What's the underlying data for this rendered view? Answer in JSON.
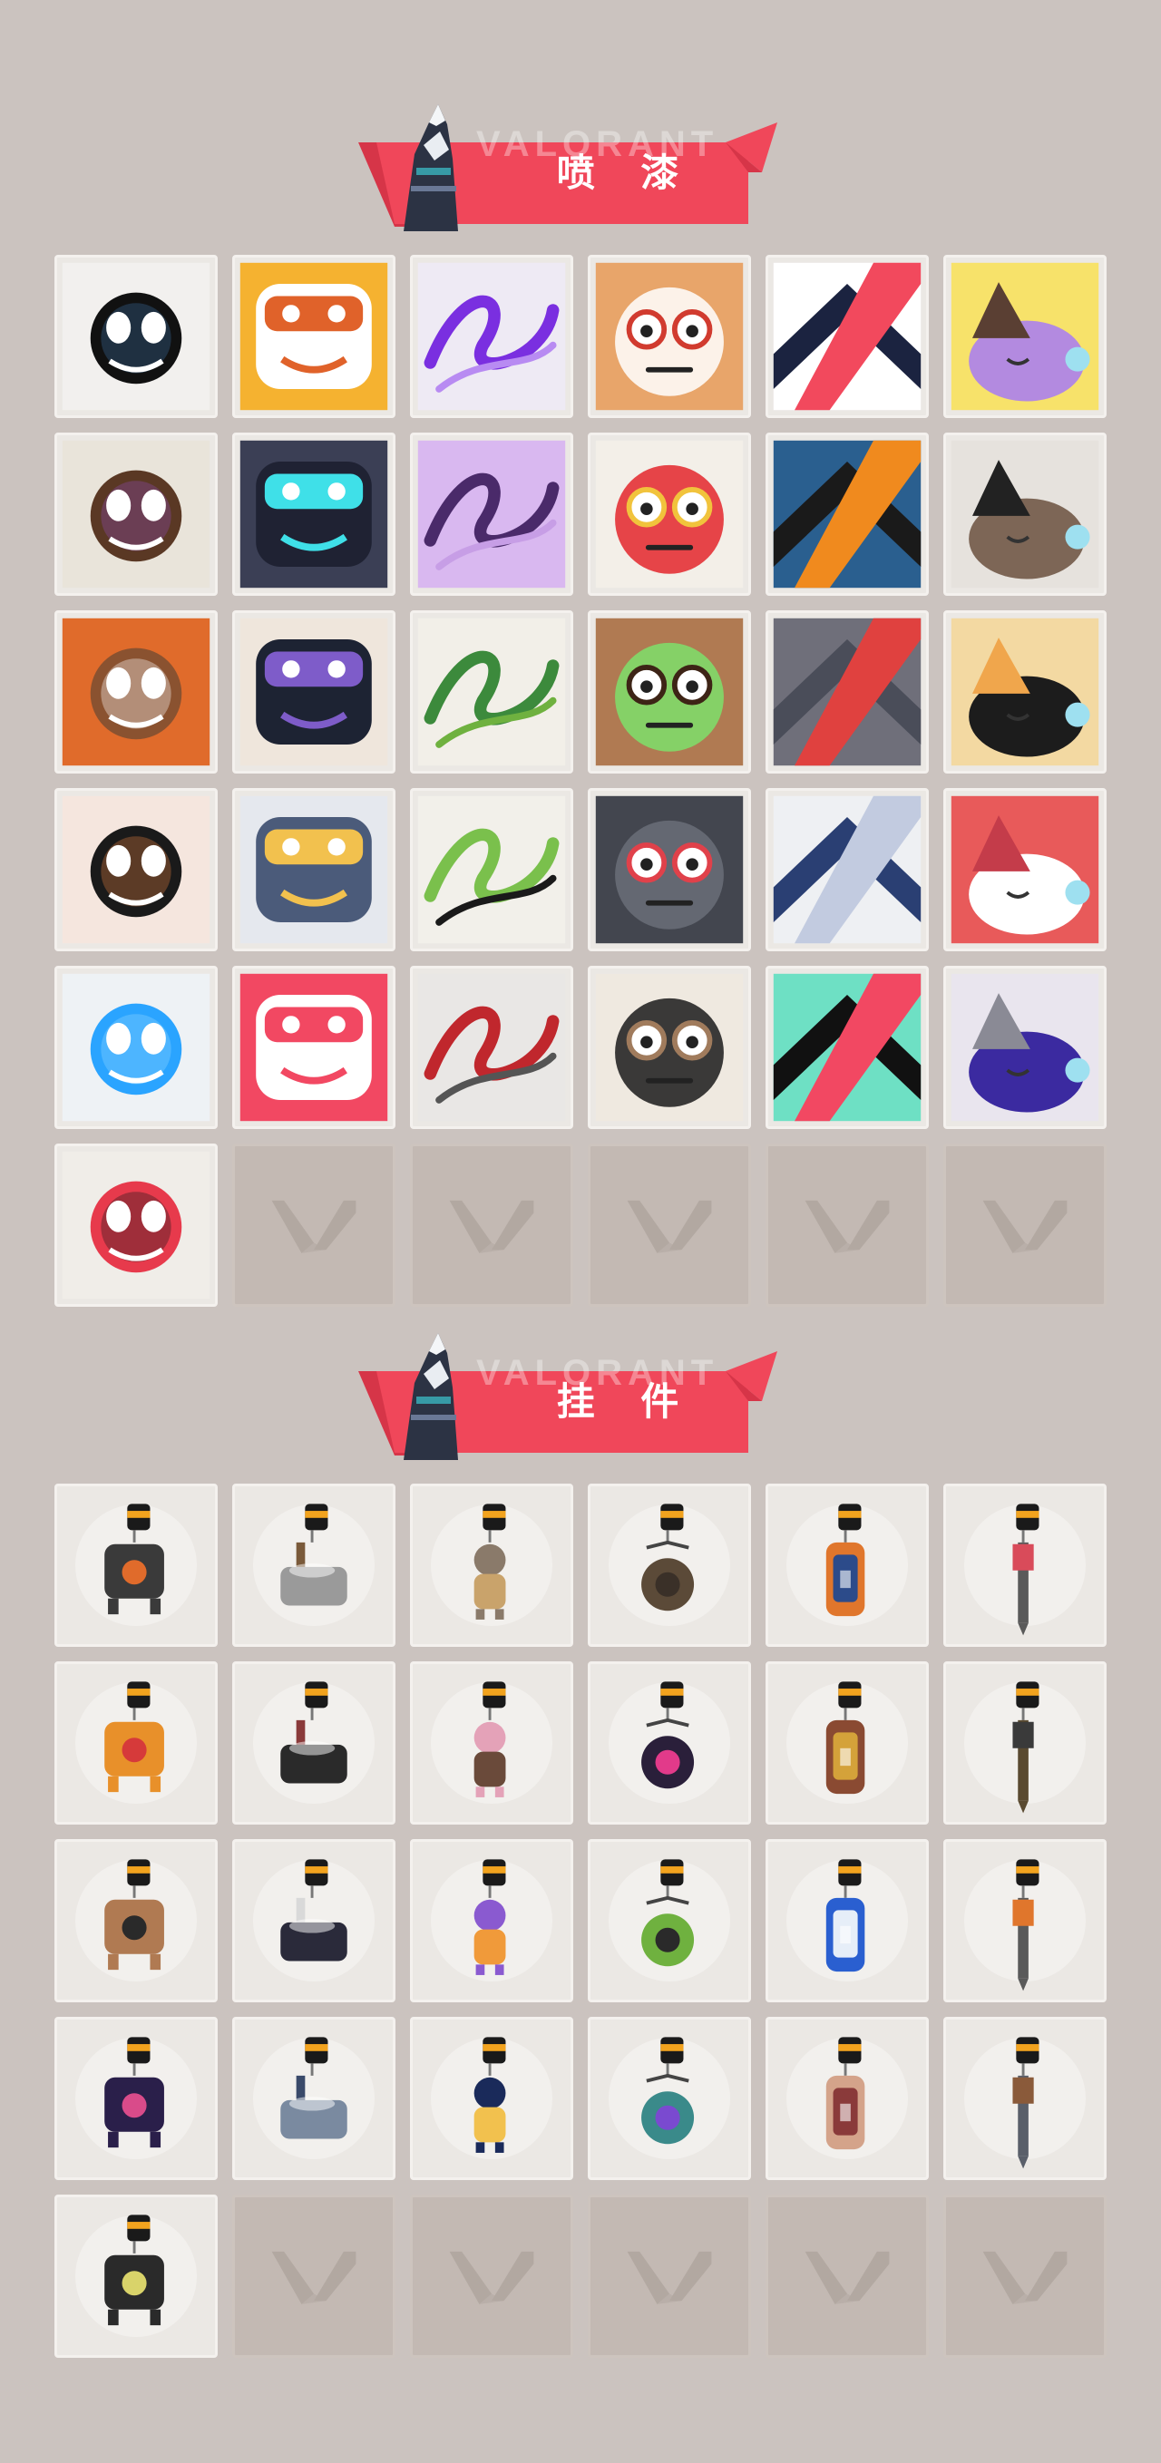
{
  "sections": [
    {
      "title": "喷  漆",
      "title_ghost": "VALORANT",
      "items": [
        {
          "icon": "star-badge-icon",
          "bg": "#f2f0ee",
          "fg": "#111111",
          "accent": "#3a6a9a"
        },
        {
          "icon": "cat-mask-icon",
          "bg": "#f5b230",
          "fg": "#ffffff",
          "accent": "#e0622a"
        },
        {
          "icon": "purple-scribble-icon",
          "bg": "#eeeaf4",
          "fg": "#7a2fe0",
          "accent": "#b88bf2"
        },
        {
          "icon": "goggles-face-icon",
          "bg": "#e8a56a",
          "fg": "#ffffff",
          "accent": "#d13b2f"
        },
        {
          "icon": "chevron-stripe-icon",
          "bg": "#ffffff",
          "fg": "#1b2340",
          "accent": "#f2495d"
        },
        {
          "icon": "sleeping-creature-icon",
          "bg": "#f7e26a",
          "fg": "#b38ae0",
          "accent": "#5a3f33"
        },
        {
          "icon": "pixel-agent-icon",
          "bg": "#e9e4da",
          "fg": "#5a3824",
          "accent": "#8b4bb0"
        },
        {
          "icon": "dark-robot-icon",
          "bg": "#3b3f55",
          "fg": "#1f2233",
          "accent": "#3fe0e8"
        },
        {
          "icon": "dizzy-face-icon",
          "bg": "#d9b8f0",
          "fg": "#4a2a6a",
          "accent": "#c79ee6"
        },
        {
          "icon": "clown-face-icon",
          "bg": "#f3efe8",
          "fg": "#e3262c",
          "accent": "#f1c33c"
        },
        {
          "icon": "orange-button-icon",
          "bg": "#2a5f8f",
          "fg": "#1a1a1a",
          "accent": "#f08a1e"
        },
        {
          "icon": "raccoon-face-icon",
          "bg": "#e6e2dd",
          "fg": "#7d6656",
          "accent": "#222222"
        },
        {
          "icon": "grinning-agent-icon",
          "bg": "#e06b2b",
          "fg": "#8a5230",
          "accent": "#ffffff"
        },
        {
          "icon": "anime-boy-icon",
          "bg": "#efe6dc",
          "fg": "#1d2333",
          "accent": "#7e5cc9"
        },
        {
          "icon": "green-crate-icon",
          "bg": "#f2efe8",
          "fg": "#3c8a3c",
          "accent": "#6fb13f"
        },
        {
          "icon": "green-eyes-icon",
          "bg": "#b07a52",
          "fg": "#7ee06b",
          "accent": "#3d2416"
        },
        {
          "icon": "crying-creature-icon",
          "bg": "#6f6f7a",
          "fg": "#4a4d59",
          "accent": "#e0413f"
        },
        {
          "icon": "tiger-face-icon",
          "bg": "#f3d9a2",
          "fg": "#1c1c1c",
          "accent": "#f0a64c"
        },
        {
          "icon": "woman-pencil-icon",
          "bg": "#f5e6de",
          "fg": "#1a1a1a",
          "accent": "#d97b3f"
        },
        {
          "icon": "penguin-beanie-icon",
          "bg": "#e5e8ee",
          "fg": "#4b5b7a",
          "accent": "#f2c14e"
        },
        {
          "icon": "frog-face-icon",
          "bg": "#f2f0ea",
          "fg": "#7ac04c",
          "accent": "#1a1a1a"
        },
        {
          "icon": "gray-monster-icon",
          "bg": "#43464f",
          "fg": "#6a6e78",
          "accent": "#e0414a"
        },
        {
          "icon": "hooded-agent-icon",
          "bg": "#eef0f3",
          "fg": "#2a3f73",
          "accent": "#c2cbe0"
        },
        {
          "icon": "number-sign-icon",
          "bg": "#e85a5a",
          "fg": "#ffffff",
          "accent": "#c43c4a"
        },
        {
          "icon": "neon-zigzag-icon",
          "bg": "#eef2f5",
          "fg": "#2aa4ff",
          "accent": "#8fd6ff"
        },
        {
          "icon": "pixel-heart-icon",
          "bg": "#f24862",
          "fg": "#ffffff",
          "accent": "#f24862"
        },
        {
          "icon": "red-x-icon",
          "bg": "#e9e7e5",
          "fg": "#c0272d",
          "accent": "#555555"
        },
        {
          "icon": "glasses-agent-icon",
          "bg": "#efe9e0",
          "fg": "#1a1a1a",
          "accent": "#a07b5c"
        },
        {
          "icon": "valorant-splat-icon",
          "bg": "#6ee0c4",
          "fg": "#111111",
          "accent": "#f24862"
        },
        {
          "icon": "graffiti-tag-icon",
          "bg": "#e9e5ee",
          "fg": "#3b2aa0",
          "accent": "#8a8a95"
        },
        {
          "icon": "red-valorant-badge-icon",
          "bg": "#f0ede8",
          "fg": "#e73a4c",
          "accent": "#1a1a1a"
        },
        {
          "icon": "empty-slot",
          "empty": true
        },
        {
          "icon": "empty-slot",
          "empty": true
        },
        {
          "icon": "empty-slot",
          "empty": true
        },
        {
          "icon": "empty-slot",
          "empty": true
        },
        {
          "icon": "empty-slot",
          "empty": true
        }
      ]
    },
    {
      "title": "挂  件",
      "title_ghost": "VALORANT",
      "items": [
        {
          "icon": "robot-drone-charm-icon",
          "body": "#3a3a3a",
          "accent": "#e06b2b"
        },
        {
          "icon": "bathtub-charm-icon",
          "body": "#9a9a9a",
          "accent": "#7a5a3a"
        },
        {
          "icon": "cat-figure-charm-icon",
          "body": "#8a7a6a",
          "accent": "#c9a36b"
        },
        {
          "icon": "round-bag-charm-icon",
          "body": "#5b4a38",
          "accent": "#3a3028"
        },
        {
          "icon": "blue-bottle-charm-icon",
          "body": "#e0762c",
          "accent": "#2c4b8a"
        },
        {
          "icon": "spiked-mace-charm-icon",
          "body": "#5a5a5a",
          "accent": "#d94b5a"
        },
        {
          "icon": "gummy-creature-charm-icon",
          "body": "#e8902a",
          "accent": "#d63a3a"
        },
        {
          "icon": "braided-rope-charm-icon",
          "body": "#2a2a2a",
          "accent": "#8a3a3a"
        },
        {
          "icon": "cupcake-charm-icon",
          "body": "#e4a2b8",
          "accent": "#6a4a3a"
        },
        {
          "icon": "ep9-medal-charm-icon",
          "body": "#2a1f3a",
          "accent": "#e23a8a"
        },
        {
          "icon": "teddy-bear-charm-icon",
          "body": "#8a4a32",
          "accent": "#d4a23a"
        },
        {
          "icon": "gun-part-charm-icon",
          "body": "#5a4a30",
          "accent": "#3a3a3a"
        },
        {
          "icon": "cardboard-box-charm-icon",
          "body": "#b07a52",
          "accent": "#2a2a2a"
        },
        {
          "icon": "ghost-lantern-charm-icon",
          "body": "#2a2a3a",
          "accent": "#d9d9d9"
        },
        {
          "icon": "lava-lamp-charm-icon",
          "body": "#8a5ad0",
          "accent": "#f09a3a"
        },
        {
          "icon": "green-handheld-charm-icon",
          "body": "#6fb13f",
          "accent": "#2a2a2a"
        },
        {
          "icon": "blue-astronaut-charm-icon",
          "body": "#2a5fd0",
          "accent": "#e6eef8"
        },
        {
          "icon": "orange-radio-charm-icon",
          "body": "#5a5a5a",
          "accent": "#e0762c"
        },
        {
          "icon": "ep9-medal-purple-charm-icon",
          "body": "#2a1f4a",
          "accent": "#d94b8a"
        },
        {
          "icon": "agent-keychain-charm-icon",
          "body": "#7a8aa0",
          "accent": "#3a4a6a"
        },
        {
          "icon": "ep9-medal-gold-charm-icon",
          "body": "#1a2a5a",
          "accent": "#f2c14e"
        },
        {
          "icon": "ufo-charm-icon",
          "body": "#3a8a8a",
          "accent": "#7a4ad0"
        },
        {
          "icon": "feather-tail-charm-icon",
          "body": "#d4a38a",
          "accent": "#8a3a3a"
        },
        {
          "icon": "gray-cat-ball-charm-icon",
          "body": "#5a5f6a",
          "accent": "#8a5a3a"
        },
        {
          "icon": "valorant-medal-charm-icon",
          "body": "#2a2a2a",
          "accent": "#d9d36a"
        },
        {
          "icon": "empty-slot",
          "empty": true
        },
        {
          "icon": "empty-slot",
          "empty": true
        },
        {
          "icon": "empty-slot",
          "empty": true
        },
        {
          "icon": "empty-slot",
          "empty": true
        },
        {
          "icon": "empty-slot",
          "empty": true
        }
      ]
    }
  ],
  "colors": {
    "background": "#cbc3bf",
    "banner_red": "#f0475a",
    "banner_dark": "#d63548",
    "empty_logo": "#b2a8a1",
    "charm_clip": "#1a1a1a",
    "charm_band": "#f2a31e"
  }
}
